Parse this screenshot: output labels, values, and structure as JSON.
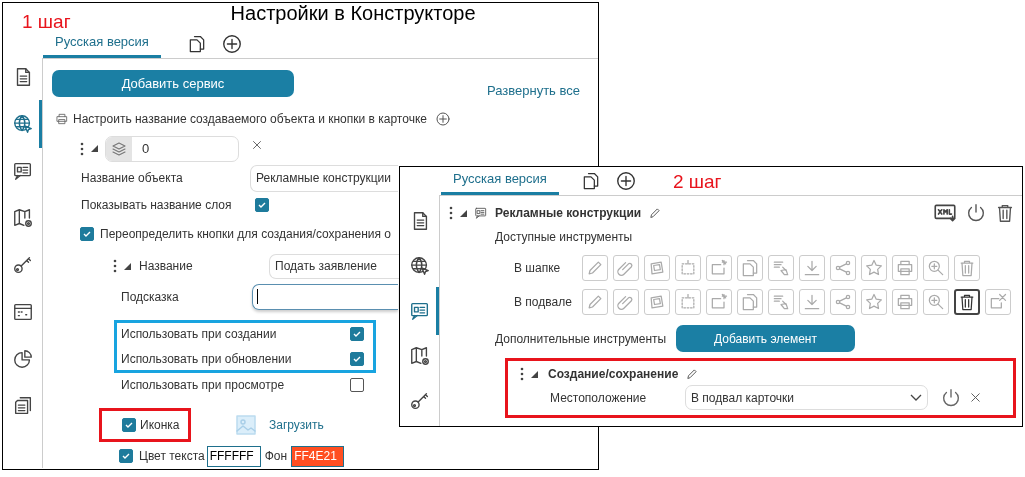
{
  "title": "Настройки в Конструкторе",
  "step1": {
    "step_label": "1 шаг",
    "tabs": [
      {
        "label": "Русская версия",
        "selected": true
      }
    ],
    "sidebar": [
      {
        "kind": "document",
        "selected": false
      },
      {
        "kind": "globe",
        "selected": true
      },
      {
        "kind": "card",
        "selected": false
      },
      {
        "kind": "map",
        "selected": false
      },
      {
        "kind": "key",
        "selected": false
      },
      {
        "kind": "panel",
        "selected": false
      },
      {
        "kind": "pie",
        "selected": false
      },
      {
        "kind": "stack",
        "selected": false
      }
    ],
    "add_button": "Добавить сервис",
    "expand_link": "Развернуть все",
    "section_label": "Настроить название создаваемого объекта и кнопки в карточке",
    "layer": {
      "value": "0"
    },
    "object_name": {
      "label": "Название объекта",
      "value": "Рекламные конструкции"
    },
    "show_layer_name": {
      "label": "Показывать название слоя",
      "checked": true
    },
    "override": {
      "label": "Переопределить кнопки для создания/сохранения о",
      "checked": true
    },
    "button_name": {
      "label": "Название",
      "value": "Подать заявление"
    },
    "hint_label": "Подсказка",
    "highlighted_usage": [
      {
        "label": "Использовать при создании",
        "checked": true
      },
      {
        "label": "Использовать при обновлении",
        "checked": true
      }
    ],
    "usage": [
      {
        "label": "Использовать при просмотре",
        "checked": false
      }
    ],
    "icon_option": {
      "label": "Иконка",
      "checked": true
    },
    "upload_link": "Загрузить",
    "text_color": {
      "label": "Цвет текста",
      "checked": true,
      "value": "FFFFFF"
    },
    "background": {
      "label": "Фон",
      "value": "FF4E21",
      "color": "#ff4e21"
    }
  },
  "step2": {
    "step_label": "2 шаг",
    "tabs": [
      {
        "label": "Русская версия",
        "selected": true
      }
    ],
    "sidebar": [
      {
        "kind": "document",
        "selected": false
      },
      {
        "kind": "globe",
        "selected": false
      },
      {
        "kind": "card",
        "selected": true
      },
      {
        "kind": "map",
        "selected": false
      },
      {
        "kind": "key",
        "selected": false
      }
    ],
    "item_title": "Рекламные конструкции",
    "tools_label": "Доступные инструменты",
    "tool_rows": [
      {
        "label": "В шапке",
        "tools": [
          {
            "kind": "pencil",
            "selected": false
          },
          {
            "kind": "clip",
            "selected": false
          },
          {
            "kind": "polygon",
            "selected": false
          },
          {
            "kind": "dotted",
            "selected": false
          },
          {
            "kind": "spark",
            "selected": false
          },
          {
            "kind": "copy",
            "selected": false
          },
          {
            "kind": "broom",
            "selected": false
          },
          {
            "kind": "download",
            "selected": false
          },
          {
            "kind": "share",
            "selected": false
          },
          {
            "kind": "star",
            "selected": false
          },
          {
            "kind": "printer",
            "selected": false
          },
          {
            "kind": "zoom",
            "selected": false
          },
          {
            "kind": "trash",
            "selected": false
          }
        ]
      },
      {
        "label": "В подвале",
        "tools": [
          {
            "kind": "pencil",
            "selected": false
          },
          {
            "kind": "clip",
            "selected": false
          },
          {
            "kind": "polygon",
            "selected": false
          },
          {
            "kind": "dotted",
            "selected": false
          },
          {
            "kind": "spark",
            "selected": false
          },
          {
            "kind": "copy",
            "selected": false
          },
          {
            "kind": "broom",
            "selected": false
          },
          {
            "kind": "download",
            "selected": false
          },
          {
            "kind": "share",
            "selected": false
          },
          {
            "kind": "star",
            "selected": false
          },
          {
            "kind": "printer",
            "selected": false
          },
          {
            "kind": "zoom",
            "selected": false
          },
          {
            "kind": "trash",
            "selected": true
          },
          {
            "kind": "remove",
            "selected": false
          }
        ]
      }
    ],
    "extra_label": "Дополнительные инструменты",
    "add_element_button": "Добавить элемент",
    "element": {
      "title": "Создание/сохранение",
      "location_label": "Местоположение",
      "location_value": "В подвал карточки"
    }
  }
}
